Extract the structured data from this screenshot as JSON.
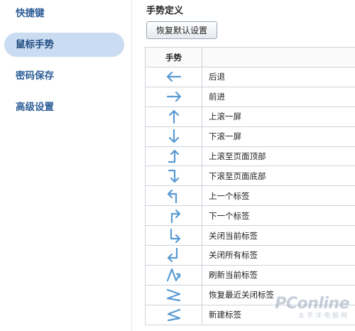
{
  "sidebar": {
    "items": [
      {
        "label": "快捷键",
        "active": false
      },
      {
        "label": "鼠标手势",
        "active": true
      },
      {
        "label": "密码保存",
        "active": false
      },
      {
        "label": "高级设置",
        "active": false
      }
    ]
  },
  "main": {
    "title": "手势定义",
    "reset_label": "恢复默认设置",
    "table": {
      "header_gesture": "手势",
      "header_action": "",
      "rows": [
        {
          "icon": "arrow-left-icon",
          "action": "后退"
        },
        {
          "icon": "arrow-right-icon",
          "action": "前进"
        },
        {
          "icon": "arrow-up-icon",
          "action": "上滚一屏"
        },
        {
          "icon": "arrow-down-icon",
          "action": "下滚一屏"
        },
        {
          "icon": "right-up-arrow-icon",
          "action": "上滚至页面顶部"
        },
        {
          "icon": "right-down-arrow-icon",
          "action": "下滚至页面底部"
        },
        {
          "icon": "up-left-arrow-icon",
          "action": "上一个标签"
        },
        {
          "icon": "up-right-arrow-icon",
          "action": "下一个标签"
        },
        {
          "icon": "down-right-arrow-icon",
          "action": "关闭当前标签"
        },
        {
          "icon": "down-left-arrow-icon",
          "action": "关闭所有标签"
        },
        {
          "icon": "up-down-zigzag-icon",
          "action": "刷新当前标签"
        },
        {
          "icon": "right-left-zigzag-icon",
          "action": "恢复最近关闭标签"
        },
        {
          "icon": "left-right-zigzag-icon",
          "action": "新建标签"
        }
      ]
    }
  },
  "watermark": {
    "logo": "PConline",
    "sub": "太平洋电脑网"
  },
  "colors": {
    "arrow": "#5a9ad4",
    "active_nav_bg": "#c9dcf2",
    "nav_text": "#2b5d96"
  }
}
